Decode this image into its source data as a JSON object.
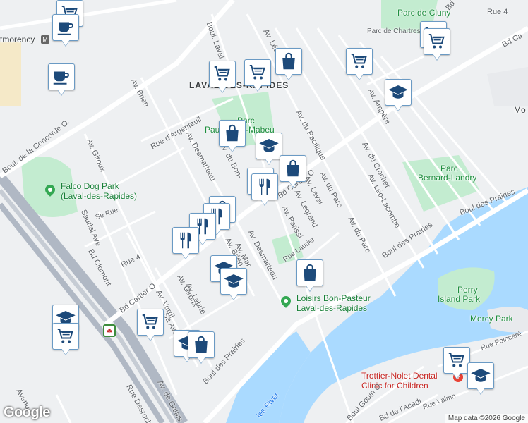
{
  "labels": {
    "montmorency": "tmorency",
    "parc_de_cluny": "Parc de Cluny",
    "rue_4_top": "Rue 4",
    "parc_de_chartres": "Parc de Chartres",
    "bd_cartier_top": "Bd Cartier O",
    "boul_laval": "Boul. Laval",
    "av_leo": "Av. Léo-",
    "laval_des_rapides": "LAVAL-DES-RAPIDES",
    "parc_paul": "Parc",
    "parc_paul2": "Paul-Émile-Mabeu",
    "mo": "Mo",
    "av_brien_top": "Av. Brien",
    "av_ampere": "Av. Ampère",
    "rue_argenteuil": "Rue d'Argenteuil",
    "av_desmarteau_top": "Av. Desmarteau",
    "av_du_bon": "Av. du Bon-",
    "av_du_pacifique": "Av. du Pacifique",
    "av_du_crochet": "Av. du Crochet",
    "bd_cartier_mid": "Bd Cartier O",
    "parc_bernard": "Parc",
    "parc_bernard2": "Bernard-Landry",
    "av_giroux_top": "Av. Giroux",
    "boul_concorde": "Boul. de la Concorde O.",
    "falco": "Falco Dog Park",
    "falco2": "(Laval-des-Rapides)",
    "av_laval": "Av. Laval",
    "av_du_parc": "Av. du Parc",
    "av_leo_lacombe": "Av. Léo-Lacombe",
    "boul_des_prairies_right": "Boul des Prairies",
    "av_legrand": "Av. Legrand",
    "saurial": "Saurial Ave",
    "se_rue": "Se Rue",
    "av_parissi": "Av. Parissi",
    "av_du_parc2": "Av. du Parc",
    "boul_des_prairies_mid": "Boul des Prairies",
    "av_desmarteau_mid": "Av. Desmarteau",
    "rue_laurier": "Rue Laurier",
    "av_brien_mid": "Av. Brien",
    "av_marie": "Av. Mar",
    "bd_clemont": "Bd Clemont",
    "rue_4_mid": "Rue 4",
    "perry": "Perry",
    "perry2": "Island Park",
    "bd_cartier_low": "Bd Cartier O",
    "av_giroux_low": "Av. Giroux",
    "av_labrie": "Av. Labrie",
    "av_verdi": "Av. Verdi",
    "loisirs": "Loisirs Bon-Pasteur",
    "loisirs2": "Laval-des-Rapides",
    "mercy": "Mercy Park",
    "rue_poincare": "Rue Poincaré",
    "trottier": "Trottier-Nolet Dental",
    "trottier2": "Clinic for Children",
    "boul_des_prairies_low": "Boul des Prairies",
    "rue_desroch": "Rue Desroch",
    "av_de_galais": "Av. de Galais",
    "avenu": "Avenu",
    "river": "ies River",
    "boul_gouin": "Boul Gouin O",
    "bd_acadi": "Bd de l'Acadi",
    "rue_valmo": "Rue Valmo",
    "sa_ave": "Sa Ave",
    "rue_4_right": "Rue 4",
    "bd_right": "Bd",
    "bd_cartier_topright": "Bd Ca",
    "google": "Google",
    "attribution": "Map data ©2026 Google"
  },
  "colors": {
    "water": "#aadaff",
    "park": "#c3ecd0",
    "road_major": "#ffffff",
    "marker_icon": "#1d4a7a"
  },
  "markers": [
    {
      "icon": "grocery-cart"
    },
    {
      "icon": "coffee"
    },
    {
      "icon": "coffee"
    },
    {
      "icon": "grocery-cart"
    },
    {
      "icon": "grocery-cart"
    },
    {
      "icon": "shopping-bag"
    },
    {
      "icon": "grocery-cart"
    },
    {
      "icon": "grocery-cart"
    },
    {
      "icon": "school"
    },
    {
      "icon": "grocery-cart"
    },
    {
      "icon": "shopping-bag"
    },
    {
      "icon": "school"
    },
    {
      "icon": "shopping-bag"
    },
    {
      "icon": "restaurant"
    },
    {
      "icon": "restaurant"
    },
    {
      "icon": "shopping-bag"
    },
    {
      "icon": "restaurant"
    },
    {
      "icon": "restaurant"
    },
    {
      "icon": "restaurant"
    },
    {
      "icon": "school"
    },
    {
      "icon": "school"
    },
    {
      "icon": "shopping-bag"
    },
    {
      "icon": "school"
    },
    {
      "icon": "grocery-cart"
    },
    {
      "icon": "grocery-cart"
    },
    {
      "icon": "school"
    },
    {
      "icon": "shopping-bag"
    },
    {
      "icon": "grocery-cart"
    },
    {
      "icon": "school"
    }
  ]
}
